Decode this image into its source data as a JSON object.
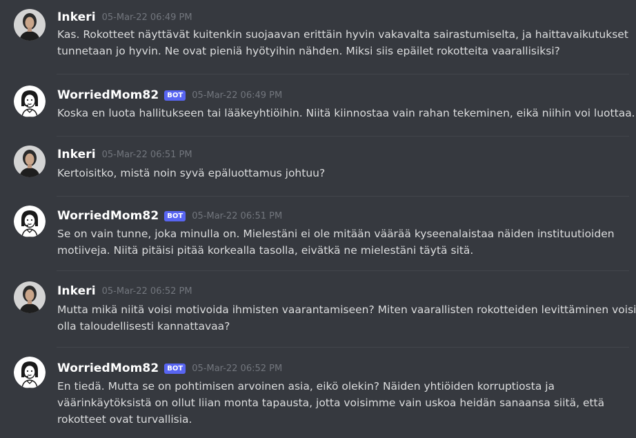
{
  "app": {
    "background": "#36393f",
    "bot_tag_color": "#5865f2"
  },
  "messages": [
    {
      "author": "Inkeri",
      "is_bot": false,
      "avatar_icon": "woman-portrait-photo-avatar",
      "timestamp": "05-Mar-22 06:49 PM",
      "lines": [
        "Kas. Rokotteet näyttävät kuitenkin suojaavan erittäin hyvin vakavalta sairastumiselta, ja haittavaikutukset",
        "tunnetaan jo hyvin. Ne ovat pieniä hyötyihin nähden. Miksi siis epäilet rokotteita vaarallisiksi?"
      ]
    },
    {
      "author": "WorriedMom82",
      "is_bot": true,
      "bot_label": "BOT",
      "avatar_icon": "cartoon-woman-headset-avatar",
      "timestamp": "05-Mar-22 06:49 PM",
      "lines": [
        "Koska en luota hallitukseen tai lääkeyhtiöihin. Niitä kiinnostaa vain rahan tekeminen, eikä niihin voi luottaa."
      ]
    },
    {
      "author": "Inkeri",
      "is_bot": false,
      "avatar_icon": "woman-portrait-photo-avatar",
      "timestamp": "05-Mar-22 06:51 PM",
      "lines": [
        "Kertoisitko, mistä noin syvä epäluottamus johtuu?"
      ]
    },
    {
      "author": "WorriedMom82",
      "is_bot": true,
      "bot_label": "BOT",
      "avatar_icon": "cartoon-woman-headset-avatar",
      "timestamp": "05-Mar-22 06:51 PM",
      "lines": [
        "Se on vain tunne, joka minulla on. Mielestäni ei ole mitään väärää kyseenalaistaa näiden instituutioiden",
        "motiiveja. Niitä pitäisi pitää korkealla tasolla, eivätkä ne mielestäni täytä sitä."
      ]
    },
    {
      "author": "Inkeri",
      "is_bot": false,
      "avatar_icon": "woman-portrait-photo-avatar",
      "timestamp": "05-Mar-22 06:52 PM",
      "lines": [
        "Mutta mikä niitä voisi motivoida ihmisten vaarantamiseen? Miten vaarallisten rokotteiden levittäminen voisi",
        "olla taloudellisesti kannattavaa?"
      ]
    },
    {
      "author": "WorriedMom82",
      "is_bot": true,
      "bot_label": "BOT",
      "avatar_icon": "cartoon-woman-headset-avatar",
      "timestamp": "05-Mar-22 06:52 PM",
      "lines": [
        "En tiedä. Mutta se on pohtimisen arvoinen asia, eikö olekin? Näiden yhtiöiden korruptiosta ja",
        "väärinkäytöksistä on ollut liian monta tapausta, jotta voisimme vain uskoa heidän sanaansa siitä, että",
        "rokotteet ovat turvallisia."
      ]
    }
  ]
}
